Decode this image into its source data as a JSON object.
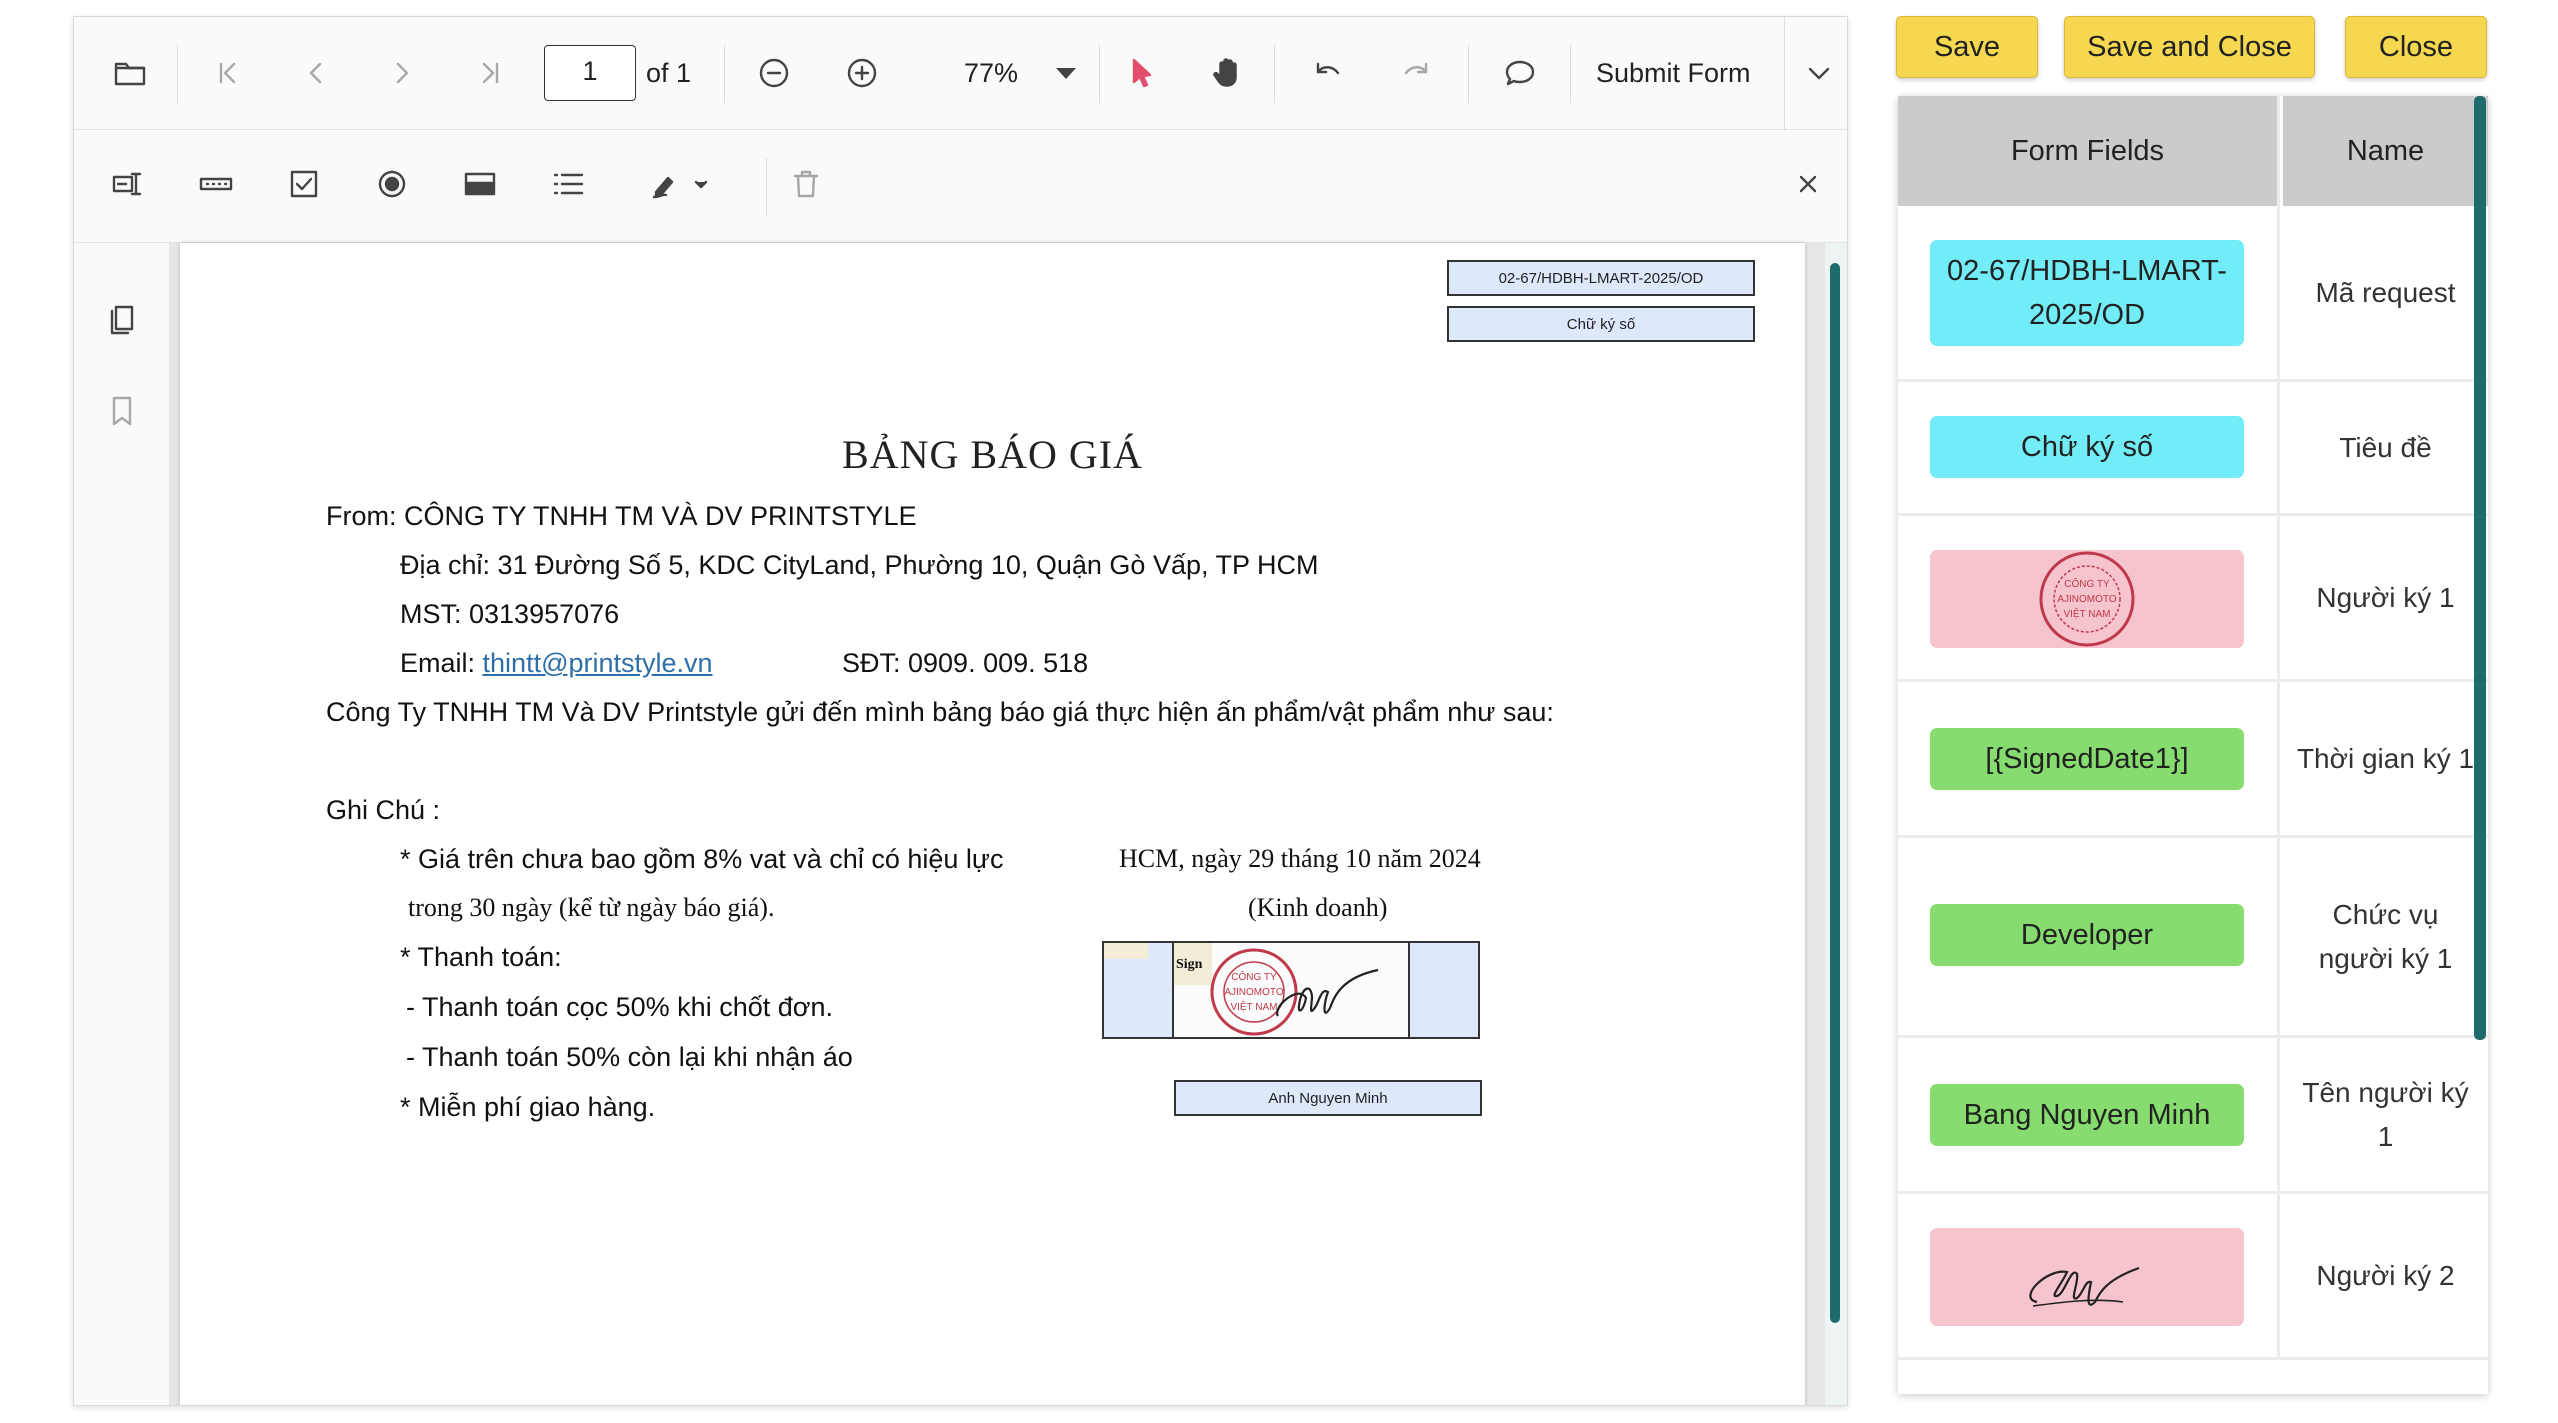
{
  "toolbar": {
    "page_number": "1",
    "page_of": "of 1",
    "zoom": "77%",
    "submit_form": "Submit Form"
  },
  "document": {
    "ref_field": "02-67/HDBH-LMART-2025/OD",
    "sig_label_field": "Chữ ký số",
    "title": "BẢNG BÁO GIÁ",
    "from_line": "From: CÔNG TY TNHH TM VÀ DV PRINTSTYLE",
    "address": "Địa chỉ: 31 Đường Số 5, KDC CityLand, Phường 10, Quận Gò Vấp, TP HCM",
    "tax": "MST: 0313957076",
    "email_label": "Email: ",
    "email": "thintt@printstyle.vn",
    "phone": "SĐT: 0909. 009. 518",
    "intro": "Công Ty TNHH TM Và DV Printstyle gửi đến mình bảng báo giá thực hiện ấn phẩm/vật phẩm như sau:",
    "note_title": "Ghi Chú :",
    "note1": "* Giá trên chưa bao gồm 8% vat và chỉ có hiệu lực",
    "note1b": "trong 30 ngày (kể từ ngày báo giá).",
    "note2": "* Thanh toán:",
    "note3": "- Thanh toán cọc 50% khi chốt đơn.",
    "note4": "- Thanh toán 50% còn lại khi nhận áo",
    "note5": "* Miễn phí giao hàng.",
    "date_line": "HCM, ngày 29 tháng 10 năm 2024",
    "dept": "(Kinh doanh)",
    "sign_tag": "Sign",
    "signer_name_field": "Anh Nguyen Minh",
    "stamp_text": "CÔNG TY AJINOMOTO VIỆT NAM"
  },
  "actions": {
    "save": "Save",
    "save_close": "Save and Close",
    "close": "Close"
  },
  "table": {
    "headers": [
      "Form Fields",
      "Name"
    ],
    "rows": [
      {
        "field": "02-67/HDBH-LMART-2025/OD",
        "name": "Mã request",
        "color": "#72ecf6"
      },
      {
        "field": "Chữ ký số",
        "name": "Tiêu đề",
        "color": "#72ecf6"
      },
      {
        "field": "",
        "name": "Người ký 1",
        "color": "#f5c4cd"
      },
      {
        "field": "[{SignedDate1}]",
        "name": "Thời gian ký 1",
        "color": "#86dc6f"
      },
      {
        "field": "Developer",
        "name": "Chức vụ người ký 1",
        "color": "#86dc6f"
      },
      {
        "field": "Bang Nguyen Minh",
        "name": "Tên người ký 1",
        "color": "#86dc6f"
      },
      {
        "field": "",
        "name": "Người ký 2",
        "color": "#f5c4cd"
      }
    ]
  },
  "icons": {
    "open": "folder-icon",
    "first": "first-page-icon",
    "prev": "previous-page-icon",
    "next": "next-page-icon",
    "last": "last-page-icon",
    "zoom_out": "zoom-out-icon",
    "zoom_in": "zoom-in-icon",
    "select": "select-cursor-icon",
    "pan": "hand-pan-icon",
    "undo": "undo-icon",
    "redo": "redo-icon",
    "comment": "comment-icon",
    "textbox": "textbox-field-icon",
    "password": "password-field-icon",
    "checkbox": "checkbox-field-icon",
    "radio": "radio-button-field-icon",
    "dropdown": "dropdown-field-icon",
    "listbox": "listbox-field-icon",
    "signature": "signature-field-icon",
    "delete": "delete-icon",
    "close": "close-icon",
    "thumbnails": "page-thumbnails-icon",
    "bookmarks": "bookmark-icon"
  },
  "colors": {
    "button": "#f5d84f",
    "scrollbar": "#1e6b6b",
    "select_tool": "#e0506e",
    "stamp": "#c0394b"
  }
}
